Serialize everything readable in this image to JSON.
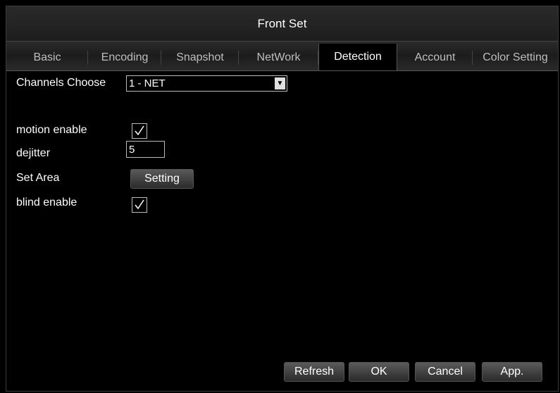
{
  "window": {
    "title": "Front Set"
  },
  "tabs": [
    {
      "label": "Basic"
    },
    {
      "label": "Encoding"
    },
    {
      "label": "Snapshot"
    },
    {
      "label": "NetWork"
    },
    {
      "label": "Detection",
      "active": true
    },
    {
      "label": "Account"
    },
    {
      "label": "Color Setting"
    }
  ],
  "form": {
    "channels_label": "Channels Choose",
    "channels_value": "1 - NET",
    "motion_label": "motion enable",
    "motion_checked": true,
    "dejitter_label": "dejitter",
    "dejitter_value": "5",
    "set_area_label": "Set Area",
    "setting_button": "Setting",
    "blind_label": "blind enable",
    "blind_checked": true
  },
  "footer": {
    "refresh": "Refresh",
    "ok": "OK",
    "cancel": "Cancel",
    "apply": "App."
  }
}
